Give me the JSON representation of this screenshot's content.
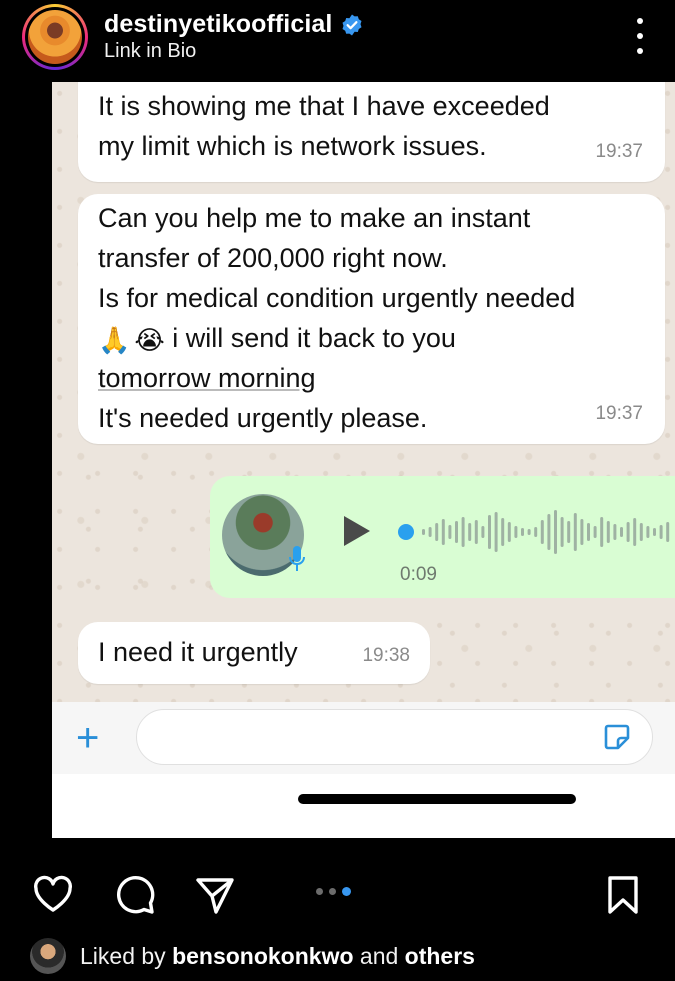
{
  "header": {
    "username": "destinyetikoofficial",
    "subtitle": "Link in Bio",
    "verified_icon": "verified-badge-icon",
    "more_icon": "more-vertical-icon"
  },
  "chat": {
    "messages": [
      {
        "lines": [
          "It is showing me that I have exceeded",
          "my limit which is network issues."
        ],
        "time": "19:37"
      },
      {
        "lines": [
          "Can you help me to make an instant",
          "transfer of 200,000 right now.",
          "Is for medical condition urgently needed",
          "i will send it back to you",
          "tomorrow morning",
          "It's needed urgently please."
        ],
        "emojis": [
          "🙏",
          "😭"
        ],
        "time": "19:37"
      },
      {
        "lines": [
          "I need it urgently"
        ],
        "time": "19:38"
      }
    ],
    "voice_note": {
      "duration": "0:09",
      "play_icon": "play-icon",
      "mic_icon": "microphone-icon"
    },
    "input": {
      "placeholder": "",
      "plus_icon": "plus-icon",
      "sticker_icon": "sticker-icon",
      "plus_glyph": "+"
    },
    "colors": {
      "incoming_bubble": "#ffffff",
      "outgoing_bubble": "#d9fdd3",
      "accent": "#2a8fd8"
    }
  },
  "actions": {
    "like_icon": "heart-icon",
    "comment_icon": "comment-icon",
    "share_icon": "send-icon",
    "save_icon": "bookmark-icon",
    "carousel_total": 3,
    "carousel_active": 3
  },
  "likes": {
    "prefix": "Liked by",
    "user": "bensonokonkwo",
    "joiner": "and",
    "others": "others"
  }
}
